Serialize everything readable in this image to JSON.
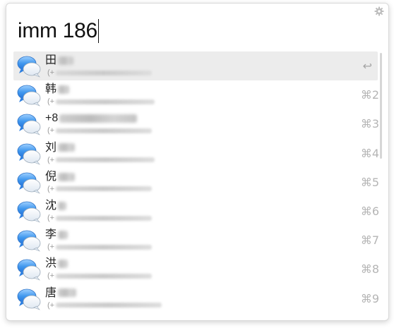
{
  "search": {
    "query": "imm 186"
  },
  "colors": {
    "selected_row": "#ececec",
    "bubble_blue": "#4a9be8"
  },
  "icons": {
    "settings": "gear-icon",
    "result": "messages-bubble-icon",
    "action": "return-icon"
  },
  "results": [
    {
      "name": "田",
      "sub_prefix": "(+",
      "shortcut": "↩",
      "selected": true
    },
    {
      "name": "韩",
      "sub_prefix": "(+",
      "shortcut": "⌘2"
    },
    {
      "name": "+8",
      "sub_prefix": "(+",
      "shortcut": "⌘3"
    },
    {
      "name": "刘",
      "sub_prefix": "(+",
      "shortcut": "⌘4"
    },
    {
      "name": "倪",
      "sub_prefix": "(+",
      "shortcut": "⌘5"
    },
    {
      "name": "沈",
      "sub_prefix": "(+",
      "shortcut": "⌘6"
    },
    {
      "name": "李",
      "sub_prefix": "(+",
      "shortcut": "⌘7"
    },
    {
      "name": "洪",
      "sub_prefix": "(+",
      "shortcut": "⌘8"
    },
    {
      "name": "唐",
      "sub_prefix": "(+",
      "shortcut": "⌘9"
    }
  ]
}
